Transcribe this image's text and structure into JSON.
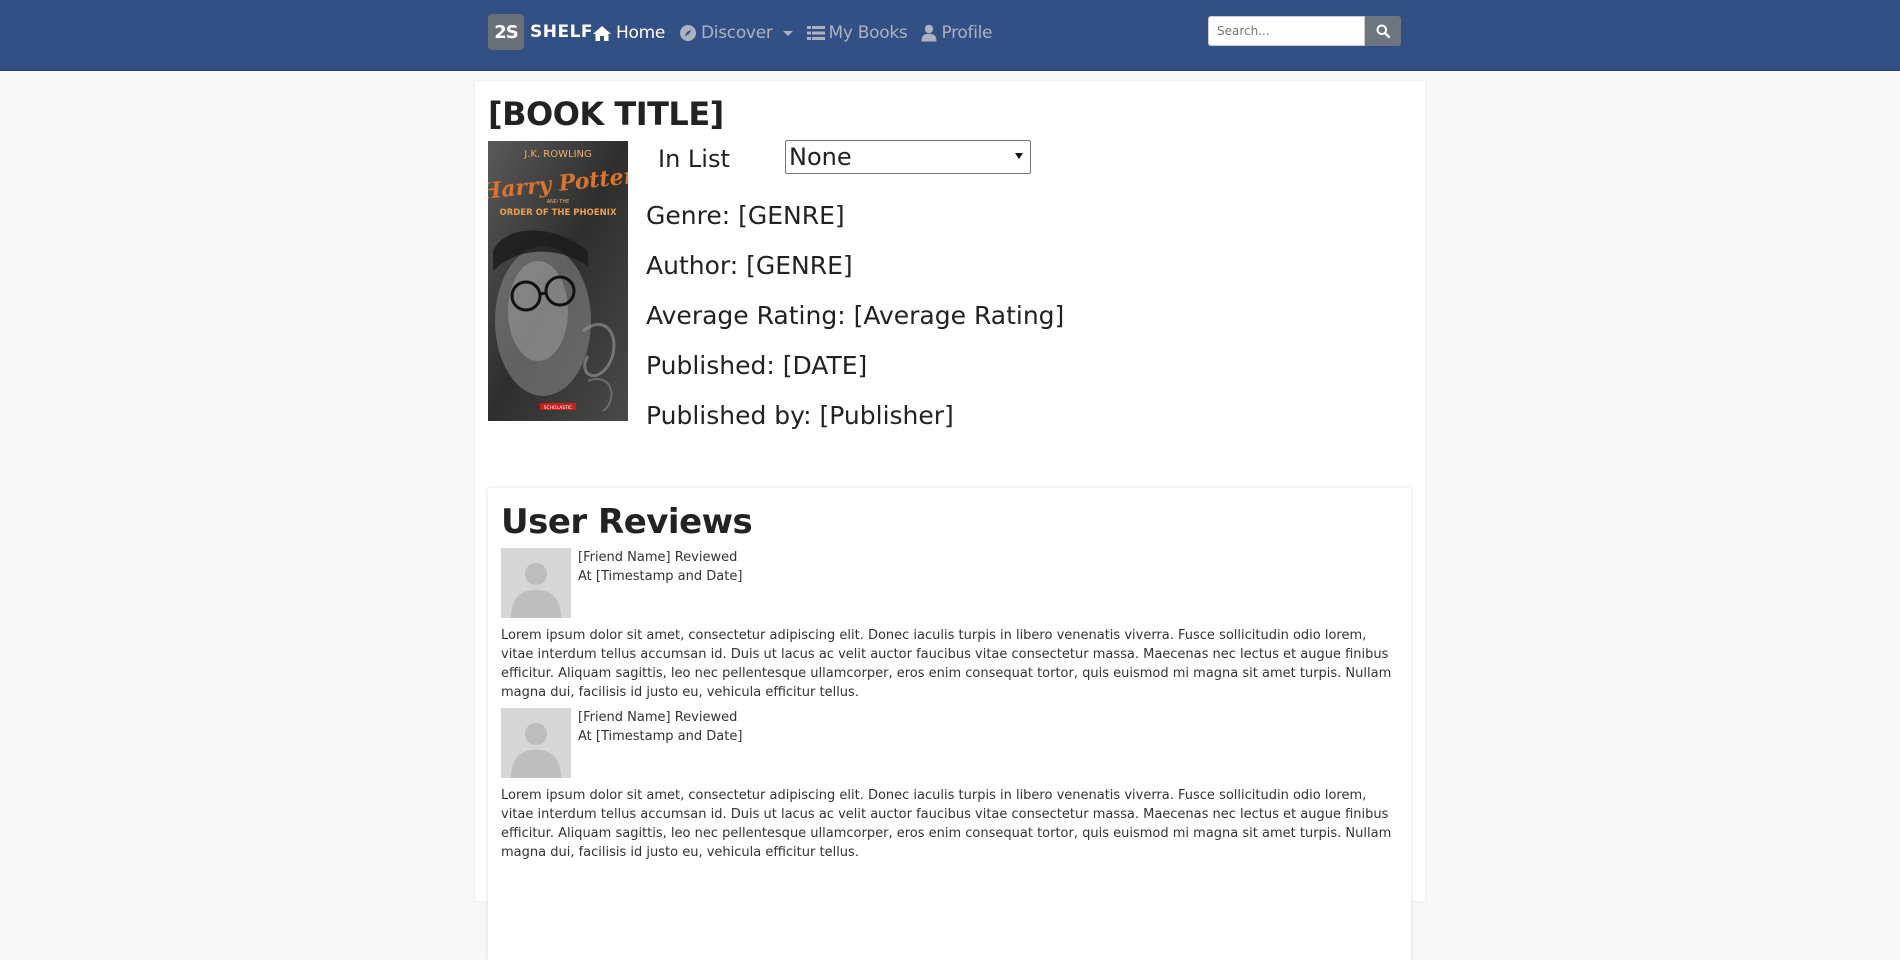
{
  "navbar": {
    "brand_logo": "2S",
    "brand_name": "SHELF",
    "items": [
      {
        "label": "Home",
        "icon": "home-icon",
        "active": true
      },
      {
        "label": "Discover",
        "icon": "compass-icon",
        "active": false,
        "dropdown": true
      },
      {
        "label": "My Books",
        "icon": "list-icon",
        "active": false
      },
      {
        "label": "Profile",
        "icon": "user-icon",
        "active": false
      }
    ],
    "search": {
      "placeholder": "Search...",
      "icon": "search-icon"
    },
    "color": "#325083"
  },
  "book": {
    "title": "[BOOK TITLE]",
    "cover_text": {
      "author": "J.K. ROWLING",
      "series": "Harry Potter",
      "and": "AND THE",
      "subtitle": "ORDER OF THE PHOENIX",
      "publisher_badge": "SCHOLASTIC"
    },
    "in_list_label": "In List",
    "in_list_value": "None",
    "genre": "Genre: [GENRE]",
    "author": "Author: [GENRE]",
    "average_rating": "Average Rating: [Average Rating]",
    "published": "Published: [DATE]",
    "published_by": "Published by: [Publisher]"
  },
  "reviews": {
    "title": "User Reviews",
    "items": [
      {
        "reviewer": "[Friend Name] Reviewed",
        "timestamp": "At [Timestamp and Date]",
        "text": "Lorem ipsum dolor sit amet, consectetur adipiscing elit. Donec iaculis turpis in libero venenatis viverra. Fusce sollicitudin odio lorem, vitae interdum tellus accumsan id. Duis ut lacus ac velit auctor faucibus vitae consectetur massa. Maecenas nec lectus et augue finibus efficitur. Aliquam sagittis, leo nec pellentesque ullamcorper, eros enim consequat tortor, quis euismod mi magna sit amet turpis. Nullam magna dui, facilisis id justo eu, vehicula efficitur tellus."
      },
      {
        "reviewer": "[Friend Name] Reviewed",
        "timestamp": "At [Timestamp and Date]",
        "text": "Lorem ipsum dolor sit amet, consectetur adipiscing elit. Donec iaculis turpis in libero venenatis viverra. Fusce sollicitudin odio lorem, vitae interdum tellus accumsan id. Duis ut lacus ac velit auctor faucibus vitae consectetur massa. Maecenas nec lectus et augue finibus efficitur. Aliquam sagittis, leo nec pellentesque ullamcorper, eros enim consequat tortor, quis euismod mi magna sit amet turpis. Nullam magna dui, facilisis id justo eu, vehicula efficitur tellus."
      }
    ]
  }
}
